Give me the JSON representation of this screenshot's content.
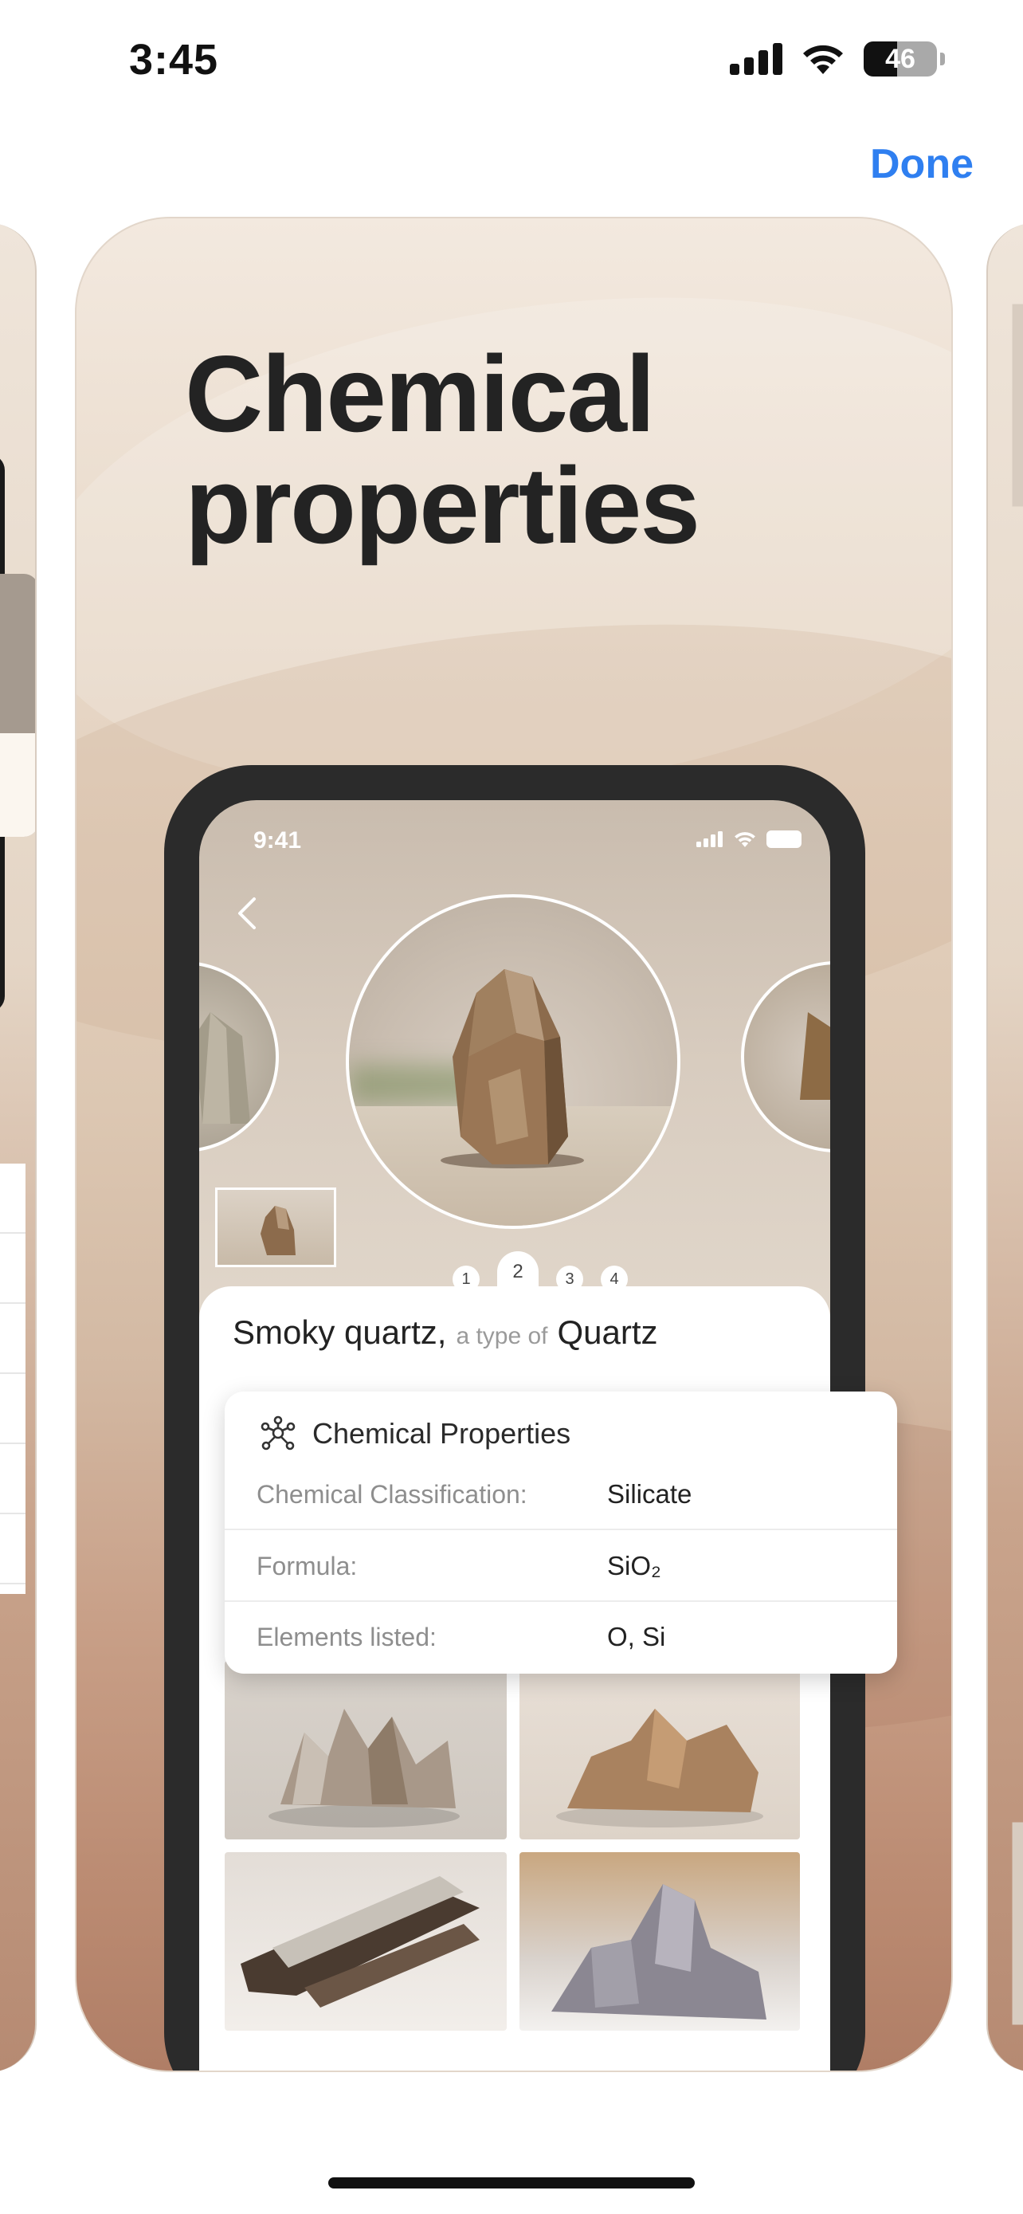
{
  "status_bar": {
    "time": "3:45",
    "battery": 46
  },
  "header": {
    "done_label": "Done"
  },
  "card": {
    "title_line1": "Chemical",
    "title_line2": "properties"
  },
  "mock_phone": {
    "time": "9:41",
    "pager": [
      "1",
      "2",
      "3",
      "4"
    ],
    "active_page": 2,
    "mineral_name": "Smoky quartz,",
    "type_of_text": "a type of",
    "mineral_type": "Quartz"
  },
  "properties": {
    "heading": "Chemical Properties",
    "rows": [
      {
        "label": "Chemical Classification:",
        "value": "Silicate"
      },
      {
        "label": "Formula:",
        "value": "SiO₂"
      },
      {
        "label": "Elements listed:",
        "value": "O, Si"
      }
    ]
  },
  "icons": {
    "signal": "cellular-signal-icon",
    "wifi": "wifi-icon",
    "battery": "battery-icon",
    "back": "chevron-left-icon",
    "properties": "molecule-icon"
  },
  "colors": {
    "accent": "#2f7ff0",
    "text": "#232323"
  }
}
